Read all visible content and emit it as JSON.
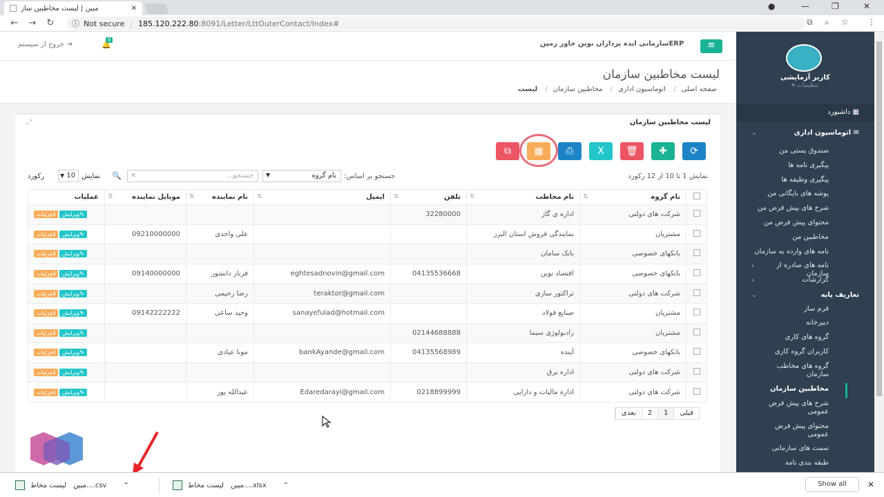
{
  "browser": {
    "tab_title": "مبین | لیست مخاطبین ساز",
    "not_secure": "Not secure",
    "url_host": "185.120.222.80",
    "url_path": ":8091/Letter/LttOuterContact/Index#"
  },
  "topbar": {
    "logout": "خروج از سیستم",
    "badge": "0",
    "org": "ERPسازمانی ایده پردازان نوین خاور زمین"
  },
  "page": {
    "title": "لیست مخاطبین سازمان",
    "breadcrumb": [
      "صفحه اصلی",
      "اتوماسیون اداری",
      "مخاطبین سازمان",
      "لیست"
    ]
  },
  "box": {
    "title": "لیست مخاطبین سازمان",
    "info": "نمایش 1 تا 10 از 12 رکورد",
    "search_by": "جستجو بر اساس:",
    "search_field": "نام گروه",
    "search_placeholder": "جستجو...",
    "show_label": "نمایش",
    "show_value": "10",
    "show_suffix": "رکورد"
  },
  "table": {
    "headers": [
      "نام گروه",
      "نام مخاطب",
      "تلفن",
      "ایمیل",
      "نام نماینده",
      "موبایل نماینده",
      "عملیات"
    ],
    "edit_label": "ویرایش",
    "detail_label": "جزئیات",
    "rows": [
      [
        "شرکت های دولتی",
        "اداره ی گاز",
        "32280000",
        "",
        "",
        ""
      ],
      [
        "مشتریان",
        "نمایندگی فروش استان البرز",
        "",
        "",
        "علی واحدی",
        "09210000000"
      ],
      [
        "بانکهای خصوصی",
        "بانک سامان",
        "",
        "",
        "",
        ""
      ],
      [
        "بانکهای خصوصی",
        "اقتصاد نوین",
        "04135536668",
        "eghtesadnovin@gmail.com",
        "فرناز دانشور",
        "09140000000"
      ],
      [
        "شرکت های دولتی",
        "تراکتور سازی",
        "",
        "teraktor@gmail.com",
        "رضا رحیمی",
        ""
      ],
      [
        "مشتریان",
        "صنایع فولاد",
        "",
        "sanayefulad@hotmail.com",
        "وحید ساعی",
        "09142222222"
      ],
      [
        "مشتریان",
        "رادیولوژی سیما",
        "02144688888",
        "",
        "",
        ""
      ],
      [
        "بانکهای خصوصی",
        "آینده",
        "04135568989",
        "bankAyande@gmail.com",
        "مونا عبادی",
        ""
      ],
      [
        "شرکت های دولتی",
        "اداره برق",
        "",
        "",
        "",
        ""
      ],
      [
        "شرکت های دولتی",
        "اداره مالیات و دارایی",
        "0218899999",
        "Edaredarayi@gmail.com",
        "عبدالله پور",
        ""
      ]
    ]
  },
  "pager": [
    "قبلی",
    "1",
    "2",
    "بعدی"
  ],
  "sidebar": {
    "user": "کاربر آزمایشی",
    "settings": "تنظیمات",
    "dashboard": "داشبورد",
    "group1": "اتوماسیون اداری",
    "g1items": [
      "صندوق پستی من",
      "پیگیری نامه ها",
      "پیگیری وظیفه ها",
      "پوشه های بایگانی من",
      "شرح های پیش فرض من",
      "محتوای پیش فرض من",
      "مخاطبین من",
      "نامه های وارده به سازمان",
      "نامه های صادره از سازمان",
      "گزارشات"
    ],
    "group2": "تعاریف پایه",
    "g2items": [
      "فرم ساز",
      "دبیرخانه",
      "گروه های کاری",
      "کاربران گروه کاری",
      "گروه های مخاطب سازمان",
      "مخاطبین سازمان",
      "شرح های پیش فرض عمومی",
      "محتوای پیش فرض عمومی",
      "سمت های سازمانی",
      "طبقه بندی نامه"
    ]
  },
  "downloads": {
    "d1": "لیست مخاط",
    "d1b": "مبین....csv",
    "d2": "لیست مخاط",
    "d2b": "مبین....xlsx",
    "show_all": "Show all"
  },
  "colors": {
    "green": "#1ab394",
    "red": "#ed5565",
    "yellow": "#f8ac59",
    "navy": "#1c84c6",
    "teal": "#23c6c8",
    "sidebar": "#2f4050"
  }
}
